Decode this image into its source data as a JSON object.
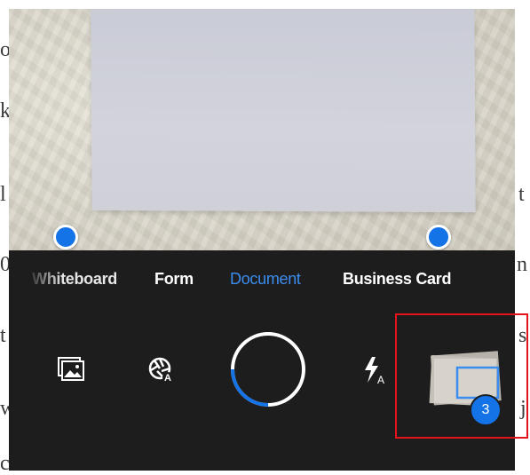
{
  "background_text": {
    "left_fragments": [
      "o",
      "k",
      "l",
      "0",
      "t",
      "w",
      "c"
    ],
    "right_fragments": [
      "t",
      "n",
      "s",
      "j"
    ]
  },
  "camera": {
    "modes": [
      {
        "id": "whiteboard",
        "label": "Whiteboard"
      },
      {
        "id": "form",
        "label": "Form"
      },
      {
        "id": "document",
        "label": "Document",
        "selected": true
      },
      {
        "id": "business",
        "label": "Business Card"
      }
    ],
    "controls": {
      "gallery_icon": "image-gallery-icon",
      "auto_capture_icon": "auto-capture-icon",
      "shutter_icon": "shutter-button",
      "flash_icon": "flash-auto-icon"
    },
    "captured_count": "3",
    "colors": {
      "accent": "#1473e6",
      "selected_mode": "#3b8df0",
      "highlight": "#e5141a",
      "panel": "#1d1d1d"
    }
  }
}
